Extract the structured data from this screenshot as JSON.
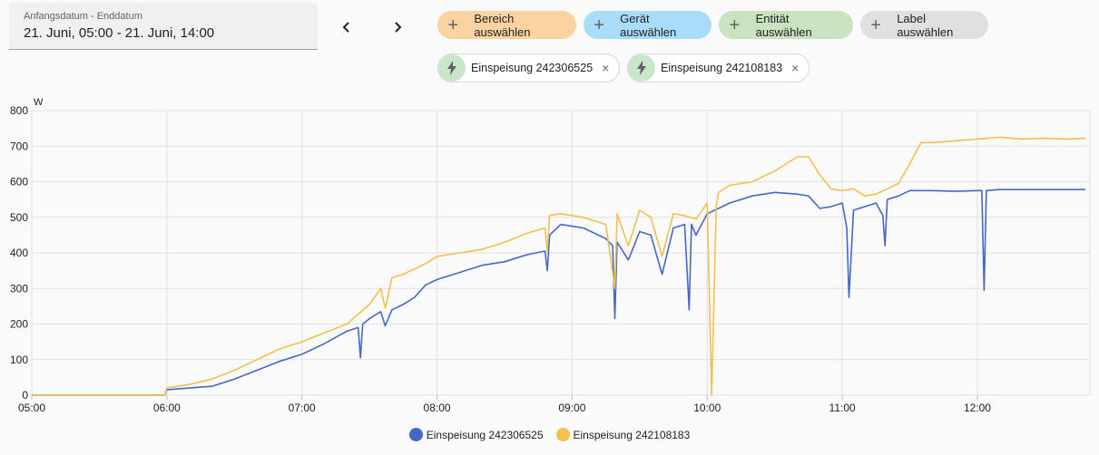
{
  "date_range": {
    "label": "Anfangsdatum - Enddatum",
    "value": "21. Juni, 05:00 - 21. Juni, 14:00"
  },
  "nav": {
    "prev": "‹",
    "next": "›"
  },
  "target_chips": [
    {
      "label": "Bereich auswählen",
      "bg": "#fbd3a2"
    },
    {
      "label": "Gerät auswählen",
      "bg": "#a9dcf8"
    },
    {
      "label": "Entität auswählen",
      "bg": "#c9e3c0"
    },
    {
      "label": "Label auswählen",
      "bg": "#e0e0e0"
    }
  ],
  "selected": [
    {
      "label": "Einspeisung 242306525",
      "remove": "×"
    },
    {
      "label": "Einspeisung 242108183",
      "remove": "×"
    }
  ],
  "chart_data": {
    "type": "line",
    "ylabel": "W",
    "ylim": [
      0,
      800
    ],
    "yticks": [
      "0",
      "100",
      "200",
      "300",
      "400",
      "500",
      "600",
      "700",
      "800"
    ],
    "xlim": [
      "05:00",
      "12:50"
    ],
    "xticks": [
      "05:00",
      "06:00",
      "07:00",
      "08:00",
      "09:00",
      "10:00",
      "11:00",
      "12:00"
    ],
    "grid": true,
    "legend": "bottom-center",
    "series": [
      {
        "name": "Einspeisung 242306525",
        "color": "#4667c7",
        "x": [
          "05:00",
          "05:30",
          "05:59",
          "06:00",
          "06:10",
          "06:20",
          "06:30",
          "06:40",
          "06:50",
          "07:00",
          "07:10",
          "07:20",
          "07:25",
          "07:26",
          "07:27",
          "07:30",
          "07:35",
          "07:37",
          "07:40",
          "07:45",
          "07:50",
          "07:55",
          "08:00",
          "08:10",
          "08:20",
          "08:30",
          "08:40",
          "08:48",
          "08:49",
          "08:50",
          "08:55",
          "09:00",
          "09:05",
          "09:10",
          "09:15",
          "09:18",
          "09:19",
          "09:20",
          "09:25",
          "09:30",
          "09:35",
          "09:40",
          "09:45",
          "09:50",
          "09:52",
          "09:53",
          "09:55",
          "10:00",
          "10:10",
          "10:20",
          "10:30",
          "10:40",
          "10:45",
          "10:50",
          "10:55",
          "11:00",
          "11:02",
          "11:03",
          "11:05",
          "11:10",
          "11:15",
          "11:18",
          "11:19",
          "11:20",
          "11:25",
          "11:30",
          "11:40",
          "11:50",
          "12:00",
          "12:02",
          "12:03",
          "12:04",
          "12:10",
          "12:20",
          "12:30",
          "12:40",
          "12:48"
        ],
        "values": [
          0,
          0,
          0,
          15,
          20,
          25,
          45,
          70,
          95,
          115,
          145,
          180,
          190,
          105,
          200,
          215,
          235,
          195,
          240,
          255,
          275,
          310,
          325,
          345,
          365,
          375,
          395,
          405,
          350,
          450,
          480,
          475,
          470,
          455,
          440,
          420,
          215,
          430,
          380,
          460,
          450,
          340,
          470,
          480,
          240,
          480,
          450,
          510,
          540,
          560,
          570,
          565,
          560,
          525,
          530,
          540,
          470,
          275,
          520,
          530,
          540,
          505,
          420,
          550,
          560,
          575,
          575,
          573,
          575,
          575,
          295,
          575,
          578,
          578,
          578,
          578,
          578
        ]
      },
      {
        "name": "Einspeisung 242108183",
        "color": "#f2c04f",
        "x": [
          "05:00",
          "05:30",
          "05:59",
          "06:00",
          "06:10",
          "06:20",
          "06:30",
          "06:40",
          "06:50",
          "07:00",
          "07:10",
          "07:20",
          "07:30",
          "07:35",
          "07:37",
          "07:40",
          "07:45",
          "07:50",
          "07:55",
          "08:00",
          "08:10",
          "08:20",
          "08:30",
          "08:40",
          "08:48",
          "08:49",
          "08:50",
          "08:55",
          "09:00",
          "09:05",
          "09:10",
          "09:15",
          "09:19",
          "09:20",
          "09:25",
          "09:30",
          "09:35",
          "09:40",
          "09:45",
          "09:50",
          "09:55",
          "10:00",
          "10:02",
          "10:04",
          "10:05",
          "10:10",
          "10:20",
          "10:30",
          "10:40",
          "10:45",
          "10:50",
          "10:55",
          "11:00",
          "11:05",
          "11:10",
          "11:15",
          "11:20",
          "11:25",
          "11:30",
          "11:35",
          "11:40",
          "11:50",
          "12:00",
          "12:10",
          "12:20",
          "12:30",
          "12:40",
          "12:48"
        ],
        "values": [
          0,
          0,
          0,
          20,
          30,
          45,
          70,
          100,
          130,
          150,
          175,
          200,
          255,
          300,
          245,
          330,
          340,
          355,
          370,
          390,
          400,
          410,
          430,
          455,
          470,
          405,
          505,
          510,
          505,
          500,
          490,
          480,
          300,
          510,
          420,
          520,
          500,
          390,
          510,
          505,
          495,
          540,
          0,
          530,
          570,
          590,
          600,
          630,
          670,
          670,
          620,
          580,
          575,
          580,
          560,
          565,
          580,
          595,
          650,
          710,
          710,
          715,
          720,
          725,
          720,
          722,
          720,
          722
        ]
      }
    ]
  }
}
